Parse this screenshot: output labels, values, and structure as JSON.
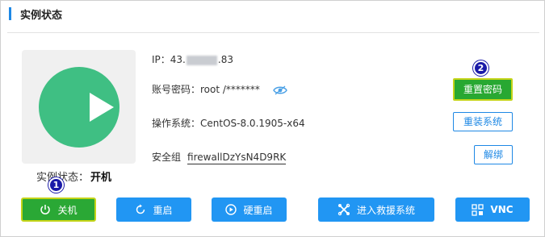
{
  "header": {
    "title": "实例状态"
  },
  "instance": {
    "state_label": "实例状态：",
    "state_value": "开机"
  },
  "info": {
    "ip_label": "IP：",
    "ip_prefix": "43.",
    "ip_suffix": ".83",
    "password_label": "账号密码：",
    "password_value": "root /*******",
    "os_label": "操作系统：",
    "os_value": "CentOS-8.0.1905-x64",
    "sg_label": "安全组",
    "sg_value": "firewallDzYsN4D9RK"
  },
  "buttons": {
    "reset_password": "重置密码",
    "reinstall": "重装系统",
    "unbind": "解绑"
  },
  "actions": {
    "shutdown": "关机",
    "restart": "重启",
    "hard_restart": "硬重启",
    "rescue": "进入救援系统",
    "vnc": "VNC"
  },
  "badges": {
    "one": "1",
    "two": "2"
  },
  "colors": {
    "accent": "#2196f3",
    "success": "#2aa835",
    "highlight_border": "#c4d418",
    "badge": "#1a1aa8",
    "play_circle": "#3fbf83"
  },
  "icons": {
    "play": "play-icon",
    "eye": "eye-icon",
    "power": "power-icon",
    "restart": "restart-icon",
    "hard_restart": "hard-restart-icon",
    "rescue": "rescue-icon",
    "vnc": "vnc-icon"
  }
}
